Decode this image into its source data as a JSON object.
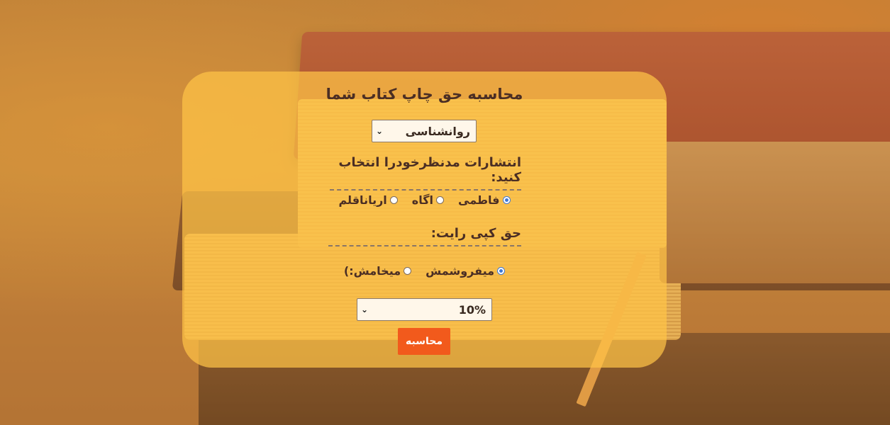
{
  "form": {
    "title": "محاسبه حق چاپ کتاب شما",
    "category_select": {
      "value": "روانشناسی"
    },
    "publisher_label": "انتشارات مدنظرخودرا انتخاب کنید:",
    "publishers": [
      {
        "label": "فاطمی",
        "checked": true
      },
      {
        "label": "اگاه",
        "checked": false
      },
      {
        "label": "ارياناقلم",
        "checked": false
      }
    ],
    "copyright_label": "حق کپی رایت:",
    "copyright_options": [
      {
        "label": "میفروشمش",
        "checked": true
      },
      {
        "label": "میخامش:)",
        "checked": false
      }
    ],
    "percent_select": {
      "value": "10%"
    },
    "calculate_button": "محاسبه"
  },
  "colors": {
    "card_bg": "#ffc446",
    "button_bg": "#f25a1c",
    "text": "#4b2e24",
    "radio_checked": "#3f78d6"
  }
}
